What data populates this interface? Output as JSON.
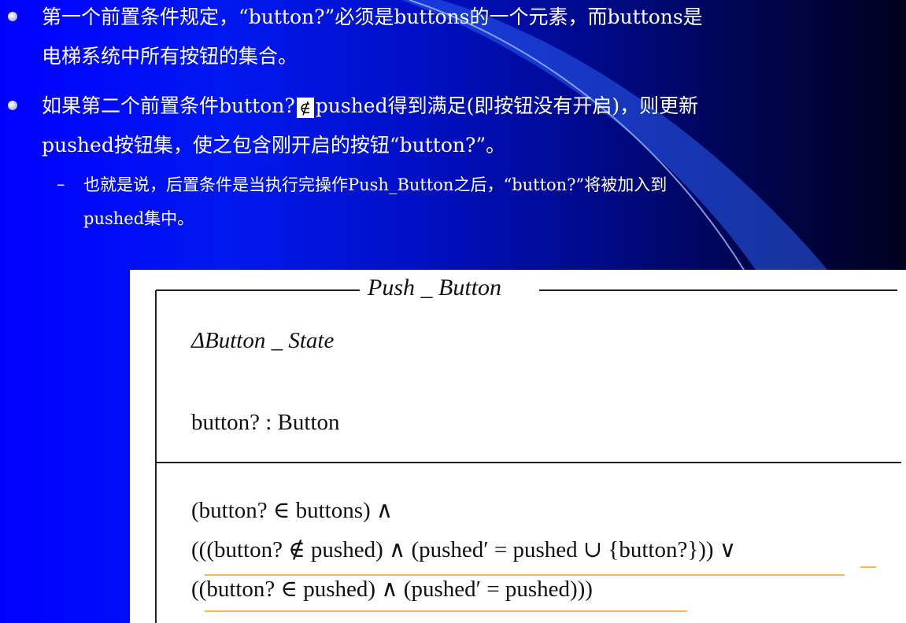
{
  "bullets": [
    {
      "lines": [
        "第一个前置条件规定，“button?”必须是buttons的一个元素，而buttons是",
        "电梯系统中所有按钮的集合。"
      ]
    },
    {
      "line1_before": "如果第二个前置条件button?",
      "line1_symbol": "∉",
      "line1_after": "pushed得到满足(即按钮没有开启)，则更新",
      "line2": "pushed按钮集，使之包含刚开启的按钮“button?”。"
    }
  ],
  "sub_bullet": {
    "marker": "–",
    "lines": [
      "也就是说，后置条件是当执行完操作Push_Button之后，“button?”将被加入到",
      "pushed集中。"
    ]
  },
  "schema": {
    "title": "Push _ Button",
    "delta": "ΔButton _ State",
    "declaration": "button? : Button",
    "predicate": [
      "(button? ∈ buttons) ∧",
      "(((button? ∉ pushed) ∧ (pushed′ = pushed ∪ {button?})) ∨",
      "((button? ∈ pushed) ∧ (pushed′ = pushed)))"
    ]
  },
  "colors": {
    "background_left": "#0000ff",
    "background_right": "#00001e",
    "text": "#ffffff",
    "underline": "#f0a030"
  }
}
